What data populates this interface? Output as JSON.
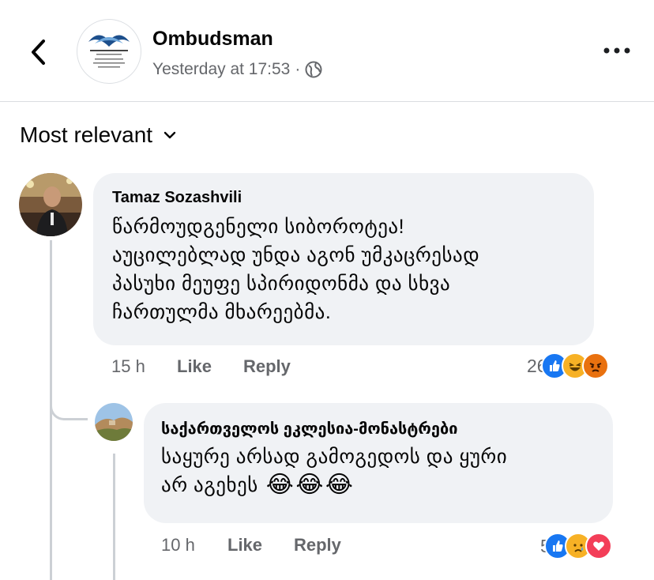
{
  "header": {
    "page_name": "Ombudsman",
    "timestamp": "Yesterday at 17:53",
    "separator": "·",
    "privacy_icon": "globe-icon",
    "back_icon": "chevron-left-icon",
    "more_icon": "more-horizontal-icon",
    "logo_lines": [
      "საქართველოს სახალხო დამცველი",
      "Public Defender",
      "(Ombudsman)",
      "of Georgia"
    ]
  },
  "sort": {
    "label": "Most relevant",
    "icon": "chevron-down-icon"
  },
  "comments": [
    {
      "author": "Tamaz Sozashvili",
      "lines": [
        "წარმოუდგენელი სიბოროტეა!",
        "აუცილებლად უნდა აგონ უმკაცრესად",
        "პასუხი მეუფე სპირიდონმა და სხვა",
        "ჩართულმა მხარეებმა."
      ],
      "time": "15 h",
      "like_label": "Like",
      "reply_label": "Reply",
      "reaction_count": "26",
      "reactions": [
        "like",
        "haha",
        "angry"
      ]
    }
  ],
  "replies": [
    {
      "author": "საქართველოს ეკლესია-მონასტრები",
      "lines": [
        "საყურე არსად გამოგედოს და ყური",
        "არ აგეხეს"
      ],
      "emojis": [
        "😂",
        "😂",
        "😂"
      ],
      "time": "10 h",
      "like_label": "Like",
      "reply_label": "Reply",
      "reaction_count": "5",
      "reactions": [
        "like",
        "sad",
        "love"
      ]
    }
  ],
  "colors": {
    "like_blue": "#1877f2",
    "haha_yellow": "#f7b125",
    "angry_orange": "#e9710f",
    "love_red": "#f33e58",
    "bubble": "#f0f2f5",
    "secondary_text": "#65676b",
    "logo_blue": "#1d4f8c"
  }
}
